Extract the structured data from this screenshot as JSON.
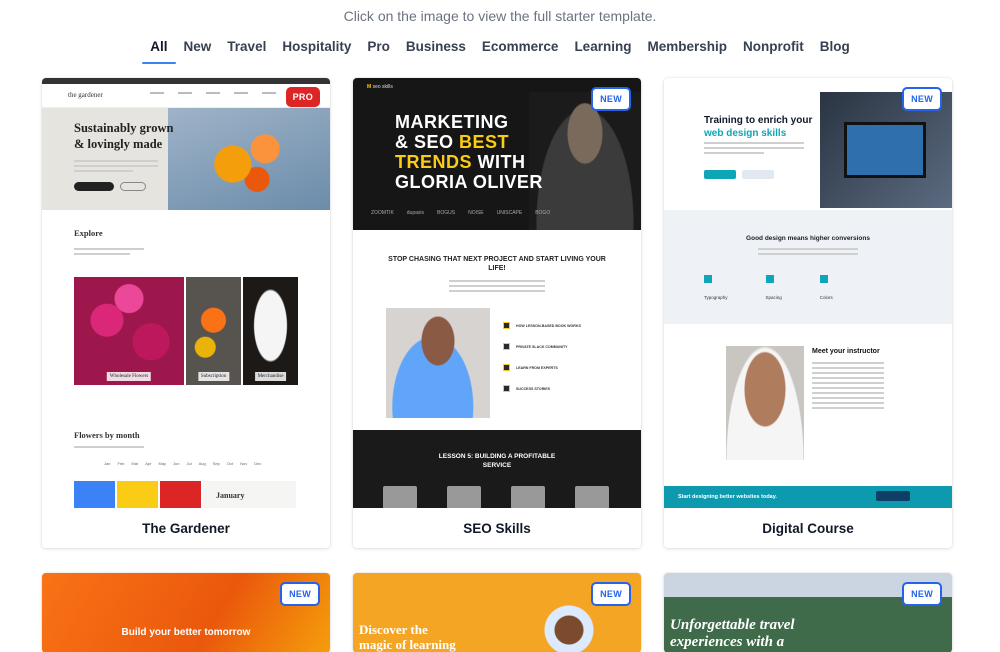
{
  "hint": "Click on the image to view the full starter template.",
  "filters": [
    "All",
    "New",
    "Travel",
    "Hospitality",
    "Pro",
    "Business",
    "Ecommerce",
    "Learning",
    "Membership",
    "Nonprofit",
    "Blog"
  ],
  "active_filter": "All",
  "accent_color": "#3b82f6",
  "cards": [
    {
      "title": "The Gardener",
      "badge": "PRO",
      "logo": "the gardener",
      "headline": "Sustainably grown & lovingly made",
      "section_1": "Explore",
      "captions": [
        "Wholesale Flowers",
        "Subscription",
        "Merchandise"
      ],
      "section_2": "Flowers by month",
      "months": [
        "Jan",
        "Feb",
        "Mar",
        "Apr",
        "May",
        "Jun",
        "Jul",
        "Aug",
        "Sep",
        "Oct",
        "Nov",
        "Dec"
      ],
      "month_card": "January"
    },
    {
      "title": "SEO Skills",
      "badge": "NEW",
      "logo_mark": "M",
      "logo": "seo skills",
      "headline_1": "MARKETING",
      "headline_2a": "& SEO ",
      "headline_2b": "BEST",
      "headline_3a": "TRENDS",
      "headline_3b": " WITH",
      "headline_4": "GLORIA OLIVER",
      "logos": [
        "ZOOMTIK",
        "dupasis",
        "BOGUS",
        "NOISE",
        "UNISCAPE",
        "BOGO"
      ],
      "stop_text": "STOP CHASING THAT NEXT PROJECT AND START LIVING YOUR LIFE!",
      "list": [
        "HOW LESSON-BASED BOOK WORKS",
        "PRIVATE SLACK COMMUNITY",
        "LEARN FROM EXPERTS",
        "SUCCESS STORIES"
      ],
      "lesson": "LESSON 5: BUILDING A PROFITABLE SERVICE"
    },
    {
      "title": "Digital Course",
      "badge": "NEW",
      "headline_1": "Training to enrich your",
      "headline_2": "web design skills",
      "section": "Good design means higher conversions",
      "features": [
        "Typography",
        "Spacing",
        "Colors"
      ],
      "meet": "Meet your instructor",
      "footer": "Start designing better websites today."
    },
    {
      "title": "",
      "badge": "NEW",
      "headline": "Build your better tomorrow"
    },
    {
      "title": "",
      "badge": "NEW",
      "headline_1": "Discover the",
      "headline_2": "magic of learning"
    },
    {
      "title": "",
      "badge": "NEW",
      "headline_1": "Unforgettable travel",
      "headline_2": "experiences with a"
    }
  ]
}
